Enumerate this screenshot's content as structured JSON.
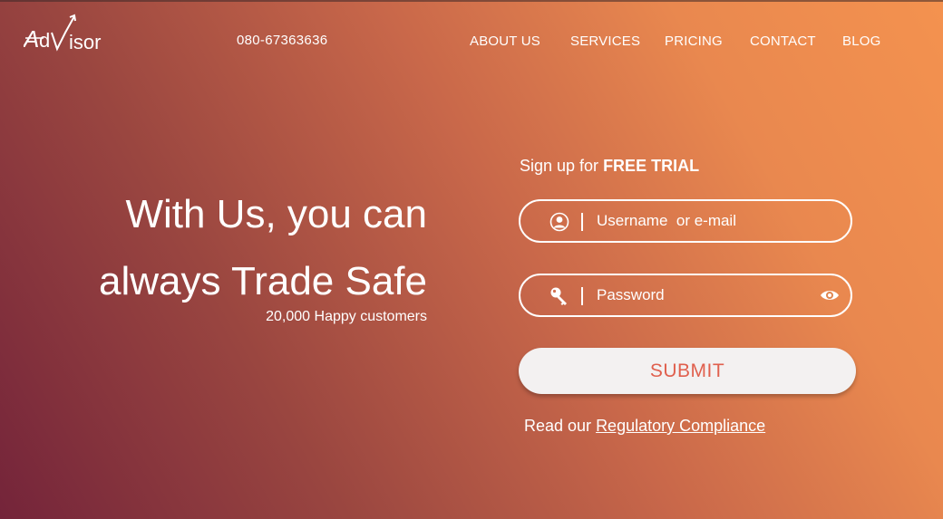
{
  "brand": {
    "logo_text": "AdVisor"
  },
  "header": {
    "phone": "080-67363636",
    "nav": [
      {
        "label": "ABOUT US"
      },
      {
        "label": "SERVICES"
      },
      {
        "label": "PRICING"
      },
      {
        "label": "CONTACT"
      },
      {
        "label": "BLOG"
      }
    ]
  },
  "hero": {
    "title_line1": "With Us, you can",
    "title_line2": "always Trade Safe",
    "subtitle": "20,000 Happy customers"
  },
  "signup": {
    "heading_prefix": "Sign up for ",
    "heading_bold": "FREE TRIAL",
    "username_placeholder": "Username  or e-mail",
    "username_value": "",
    "password_placeholder": "Password",
    "password_value": "",
    "submit_label": "SUBMIT",
    "compliance_prefix": "Read our ",
    "compliance_link": "Regulatory Compliance"
  },
  "icons": {
    "logo": "advisor-logo",
    "username": "user-icon",
    "password": "key-icon",
    "show_password": "eye-icon"
  },
  "colors": {
    "gradient_start": "#74243a",
    "gradient_end": "#f4924f",
    "submit_text": "#e0604e",
    "submit_bg": "#f3f1f1"
  }
}
